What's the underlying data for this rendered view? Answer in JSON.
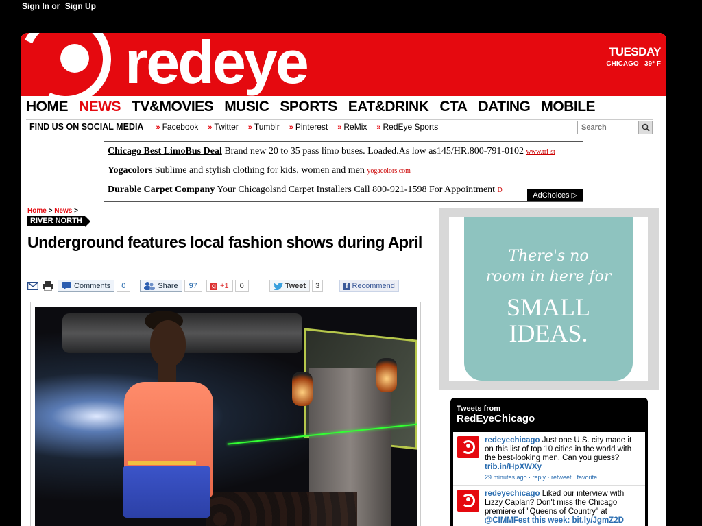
{
  "topbar": {
    "sign_in": "Sign In",
    "or": "or",
    "sign_up": "Sign Up"
  },
  "masthead": {
    "logo": "redeye",
    "day": "TUESDAY",
    "city": "CHICAGO",
    "temp": "39° F"
  },
  "nav": {
    "items": [
      {
        "label": "HOME"
      },
      {
        "label": "NEWS",
        "active": true
      },
      {
        "label": "TV&MOVIES"
      },
      {
        "label": "MUSIC"
      },
      {
        "label": "SPORTS"
      },
      {
        "label": "EAT&DRINK"
      },
      {
        "label": "CTA"
      },
      {
        "label": "DATING"
      },
      {
        "label": "MOBILE"
      }
    ]
  },
  "social": {
    "label": "FIND US ON SOCIAL MEDIA",
    "links": [
      "Facebook",
      "Twitter",
      "Tumblr",
      "Pinterest",
      "ReMix",
      "RedEye Sports"
    ],
    "search_placeholder": "Search"
  },
  "ads": {
    "rows": [
      {
        "title": "Chicago Best LimoBus Deal",
        "text": "Brand new 20 to 35 pass limo buses. Loaded.As low as145/HR.800-791-0102",
        "url": "www.tri-st"
      },
      {
        "title": "Yogacolors",
        "text": "Sublime and stylish clothing for kids, women and men",
        "url": "yogacolors.com"
      },
      {
        "title": "Durable Carpet Company",
        "text": "Your Chicagolsnd Carpet Installers Call 800-921-1598 For Appointment",
        "url": "D"
      }
    ],
    "adchoices": "AdChoices ▷"
  },
  "breadcrumb": {
    "home": "Home",
    "news": "News",
    "section": "RIVER NORTH"
  },
  "article": {
    "headline": "Underground features local fashion shows during April"
  },
  "share": {
    "comments_label": "Comments",
    "comments_count": "0",
    "share_label": "Share",
    "share_count": "97",
    "gplus_label": "+1",
    "gplus_count": "0",
    "tweet_label": "Tweet",
    "tweet_count": "3",
    "recommend_label": "Recommend"
  },
  "sidebar_ad": {
    "line1": "There's no",
    "line2": "room in here for",
    "big1": "SMALL",
    "big2": "IDEAS."
  },
  "tweets": {
    "header_small": "Tweets from",
    "header_name": "RedEyeChicago",
    "items": [
      {
        "user": "redeyechicago",
        "text": "Just one U.S. city made it on this list of top 10 cities in the world with the best-looking men. Can you guess?",
        "link": "trib.in/HpXWXy",
        "meta": "29 minutes ago · reply · retweet · favorite"
      },
      {
        "user": "redeyechicago",
        "text": "Liked our interview with Lizzy Caplan? Don't miss the Chicago premiere of \"Queens of Country\" at",
        "link": "@CIMMFest this week: bit.ly/JgmZ2D",
        "meta": ""
      }
    ]
  }
}
